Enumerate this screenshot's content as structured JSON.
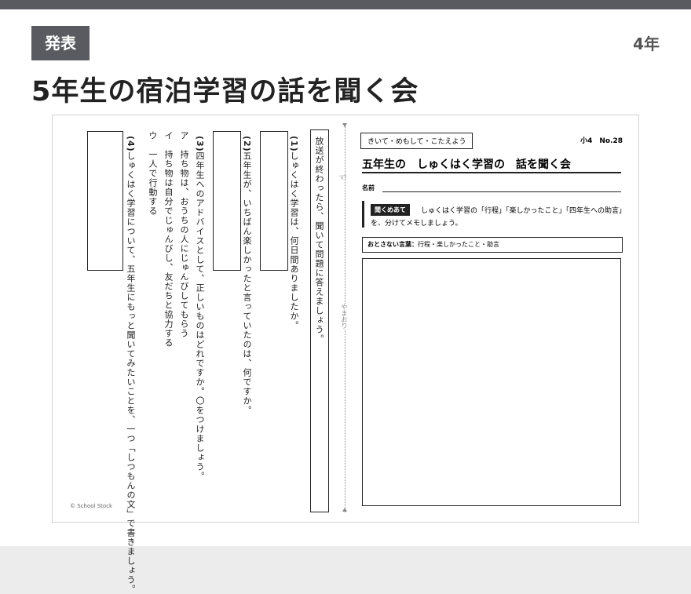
{
  "header": {
    "badge": "発表",
    "grade": "4年",
    "title": "5年生の宿泊学習の話を聞く会"
  },
  "sheet": {
    "instruction": "放送が終わったら、聞いて問題に答えましょう。",
    "q1": {
      "num": "(1)",
      "text": "しゅくはく学習は、何日間ありましたか。"
    },
    "q2": {
      "num": "(2)",
      "text": "五年生が、いちばん楽しかったと言っていたのは、何ですか。"
    },
    "q3": {
      "num": "(3)",
      "text": "四年生へのアドバイスとして、正しいものはどれですか。〇をつけましょう。",
      "options": [
        "ア　持ち物は、おうちの人にじゅんびしてもらう",
        "イ　持ち物は自分でじゅんびし、友だちと協力する",
        "ウ　一人で行動する"
      ]
    },
    "q4": {
      "num": "(4)",
      "text": "しゅくはく学習について、五年生にもっと聞いてみたいことを、一つ「しつもんの文」で書きましょう。"
    },
    "fold_label": "やまおり",
    "tag": "きいて・めもして・こたえよう",
    "number": "小4　No.28",
    "worksheet_title": "五年生の　しゅくはく学習の　話を聞く会",
    "name_label": "名前",
    "aim_badge": "聞くめあて",
    "aim_line1": "しゅくはく学習の「行程」「楽しかったこと」「四年生への助言」",
    "aim_line2": "を、分けてメモしましょう。",
    "keyword_label": "おとさない言葉：",
    "keyword_text": "行程・楽しかったこと・助言",
    "copyright": "© School Stock"
  },
  "icons": {
    "hand": "hand-icon"
  }
}
